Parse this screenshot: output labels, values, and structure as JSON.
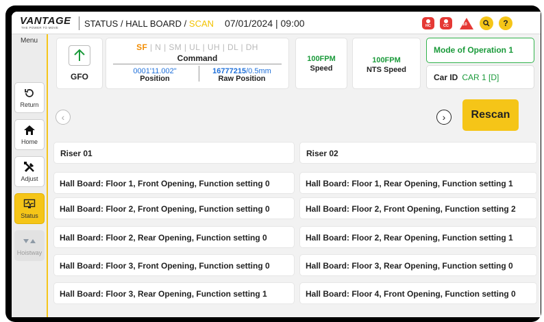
{
  "header": {
    "brand": "VANTAGE",
    "tagline": "THE POWER TO MOVE",
    "crumb_prefix": "STATUS / HALL BOARD / ",
    "crumb_current": "SCAN",
    "datetime": "07/01/2024 | 09:00",
    "alerts": [
      {
        "icon": "hc-shield-icon",
        "text": "HC"
      },
      {
        "icon": "cc-shield-icon",
        "text": "CC"
      },
      {
        "icon": "warning-triangle-icon",
        "text": "10"
      },
      {
        "icon": "search-icon",
        "text": "Q"
      },
      {
        "icon": "help-icon",
        "text": "?"
      }
    ]
  },
  "nav": {
    "menu_label": "Menu",
    "items": [
      {
        "label": "Return",
        "icon": "return-icon",
        "state": "normal"
      },
      {
        "label": "Home",
        "icon": "home-icon",
        "state": "normal"
      },
      {
        "label": "Adjust",
        "icon": "tools-icon",
        "state": "normal"
      },
      {
        "label": "Status",
        "icon": "monitor-icon",
        "state": "active"
      },
      {
        "label": "Hoistway",
        "icon": "hoistway-icon",
        "state": "disabled"
      }
    ]
  },
  "gfo": {
    "label": "GFO",
    "icon": "arrow-up-icon"
  },
  "command": {
    "flags": [
      "SF",
      "N",
      "SM",
      "UL",
      "UH",
      "DL",
      "DH"
    ],
    "active_flag": "SF",
    "title": "Command",
    "position_value": "0001'11.002\"",
    "position_label": "Position",
    "raw_value": "16777215",
    "raw_unit": "/0.5mm",
    "raw_label": "Raw Position"
  },
  "speed": {
    "value": "100FPM",
    "label": "Speed"
  },
  "nts_speed": {
    "value": "100FPM",
    "label": "NTS Speed"
  },
  "mode": {
    "text": "Mode of Operation 1"
  },
  "car": {
    "key": "Car ID",
    "value": "CAR 1 [D]"
  },
  "controls": {
    "rescan_label": "Rescan",
    "prev": "‹",
    "next": "›"
  },
  "risers": [
    {
      "title": "Riser 01",
      "rows": [
        "Hall Board: Floor 1, Front Opening, Function setting 0",
        "Hall Board: Floor 2, Front Opening, Function setting 0",
        "Hall Board: Floor 2, Rear Opening, Function setting 0",
        "Hall Board: Floor 3, Front Opening, Function setting 0",
        "Hall Board: Floor 3, Rear Opening, Function setting 1"
      ]
    },
    {
      "title": "Riser 02",
      "rows": [
        "Hall Board: Floor 1, Rear Opening, Function setting 1",
        "Hall Board: Floor 2, Front Opening, Function setting 2",
        "Hall Board: Floor 2, Rear Opening, Function setting 1",
        "Hall Board: Floor 3, Rear Opening, Function setting 0",
        "Hall Board: Floor 4, Front Opening, Function setting 0"
      ]
    }
  ],
  "colors": {
    "accent": "#f5c518",
    "ok": "#1a9a3a",
    "info": "#1e6fd9",
    "alert": "#e53935",
    "flag_on": "#f28c00"
  }
}
